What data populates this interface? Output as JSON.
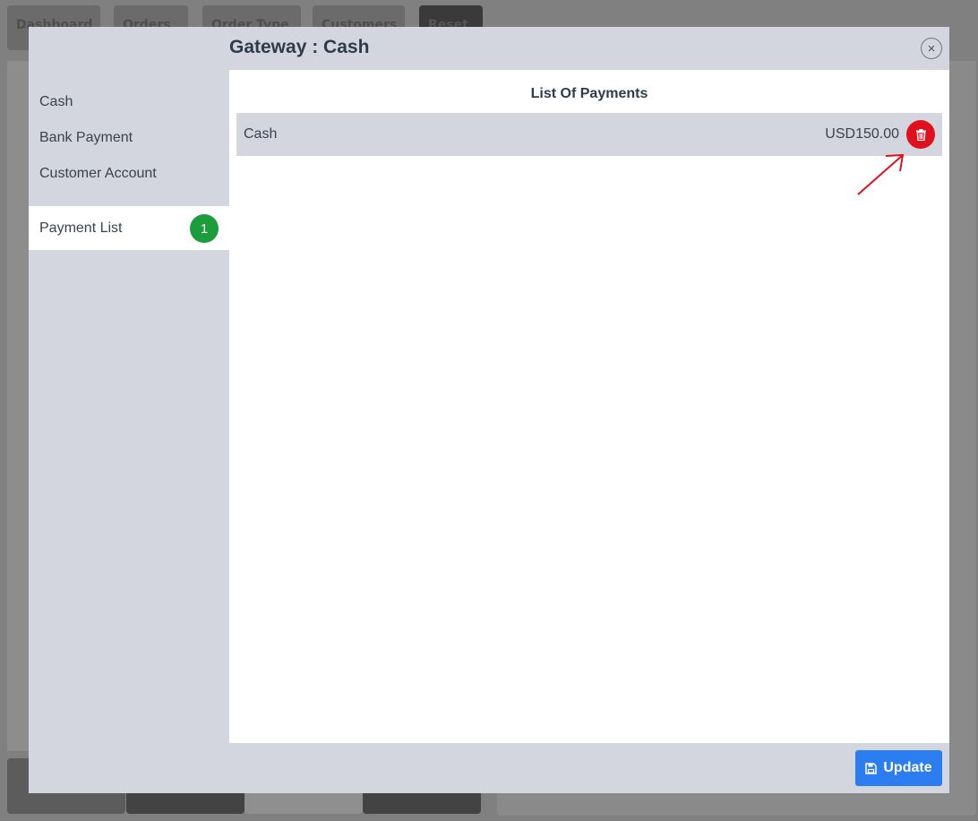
{
  "background": {
    "top_buttons": [
      "Dashboard",
      "Orders",
      "Order Type",
      "Customers",
      "Reset"
    ]
  },
  "modal": {
    "title": "Gateway : Cash",
    "close_glyph": "×",
    "sidebar": {
      "items": [
        {
          "label": "Cash"
        },
        {
          "label": "Bank Payment"
        },
        {
          "label": "Customer Account"
        },
        {
          "label": "Payment List",
          "badge": "1",
          "active": true
        }
      ]
    },
    "content": {
      "heading": "List Of Payments",
      "payments": [
        {
          "method": "Cash",
          "amount": "USD150.00"
        }
      ]
    },
    "footer": {
      "update_label": "Update"
    }
  },
  "colors": {
    "accent_blue": "#2b7df0",
    "delete_red": "#e0101e",
    "badge_green": "#1a9d3a",
    "annotation_red": "#e0101e"
  },
  "icons": {
    "close": "close-icon",
    "delete": "trash-icon",
    "update": "save-icon"
  }
}
